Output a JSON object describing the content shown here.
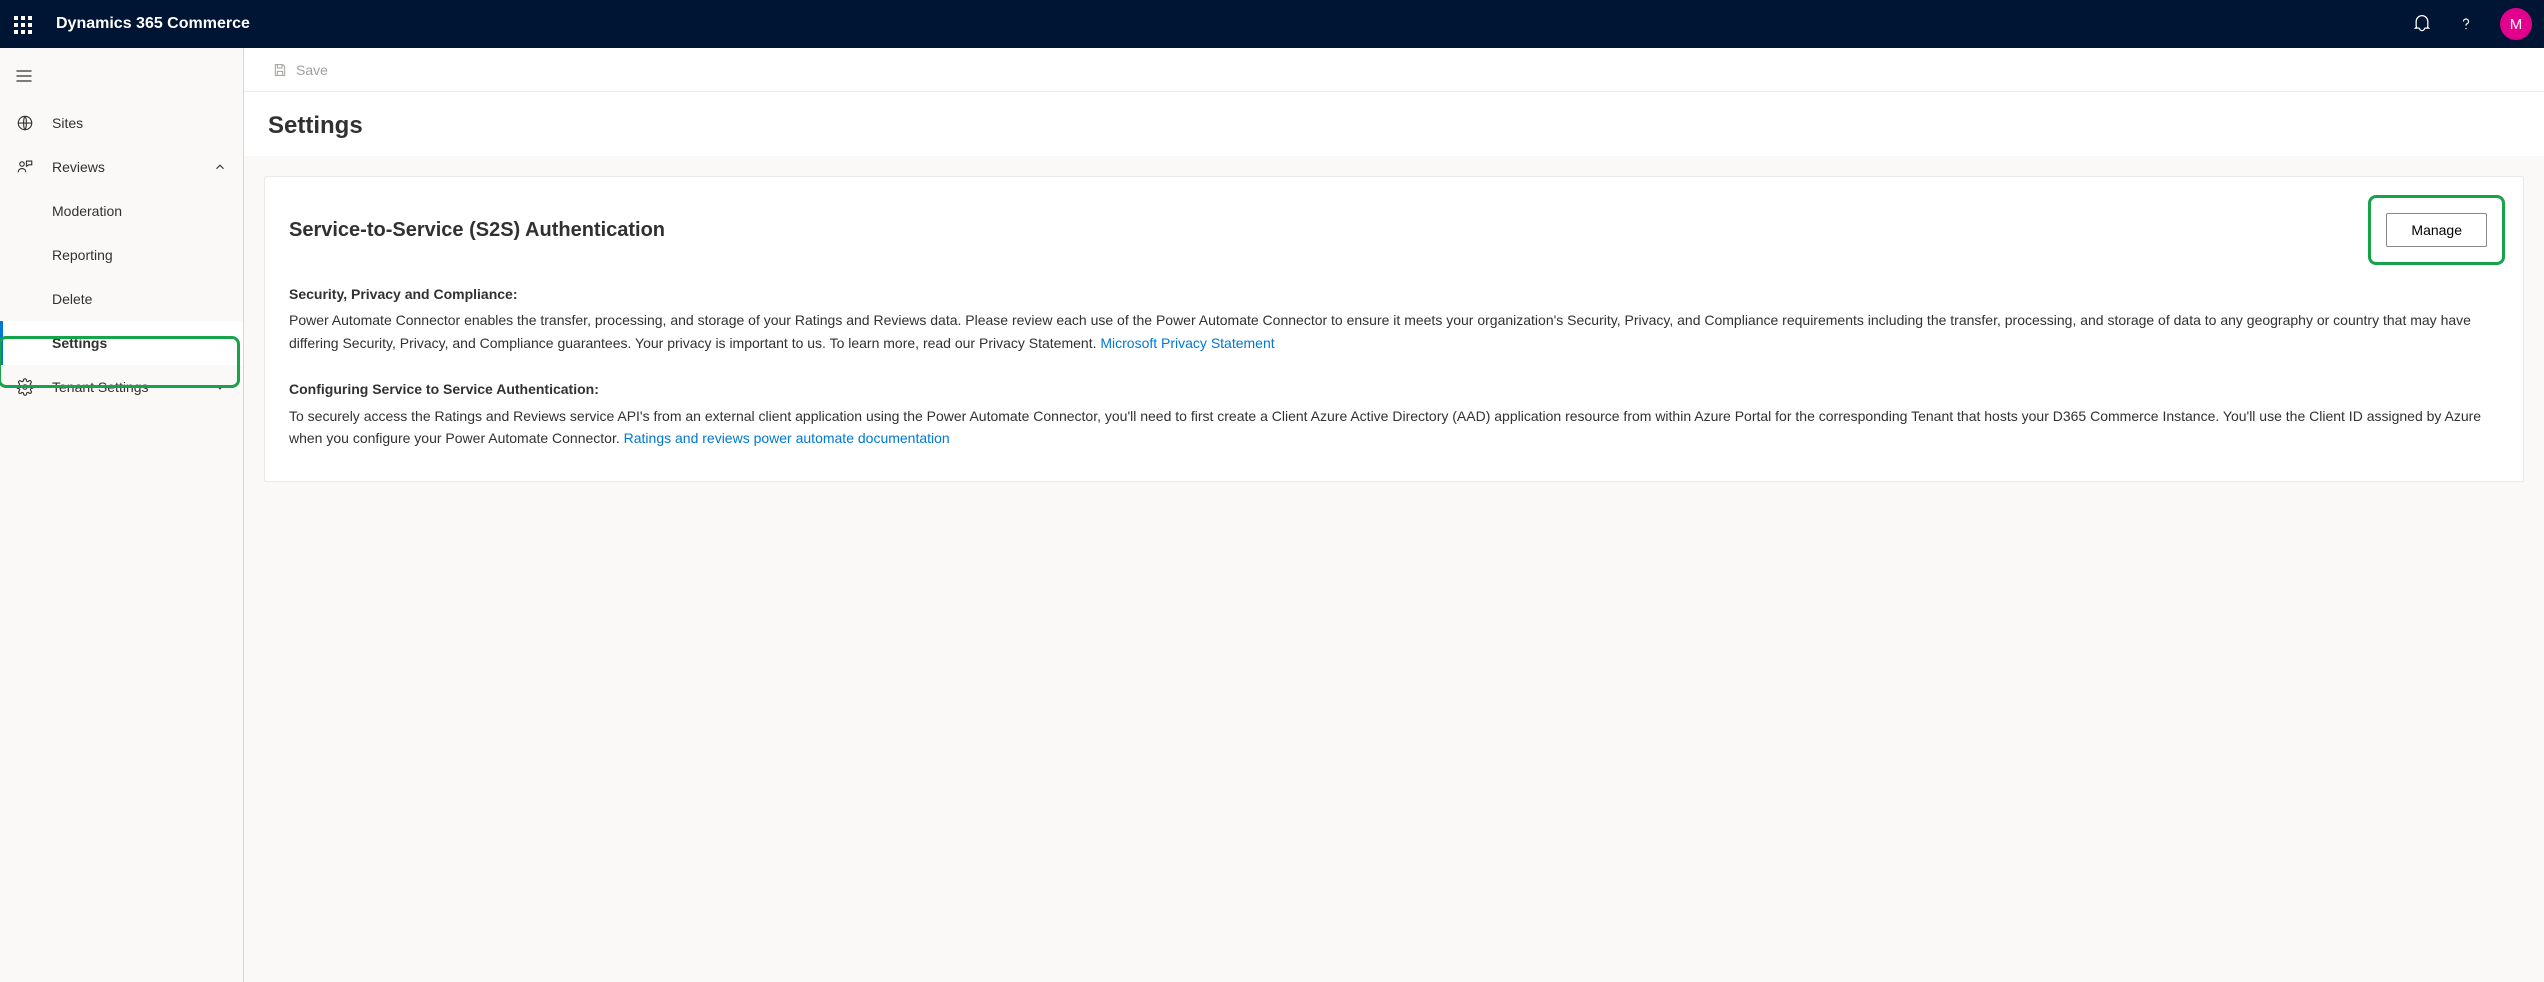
{
  "topbar": {
    "title": "Dynamics 365 Commerce",
    "avatar_initial": "M"
  },
  "sidebar": {
    "sites_label": "Sites",
    "reviews_label": "Reviews",
    "moderation_label": "Moderation",
    "reporting_label": "Reporting",
    "delete_label": "Delete",
    "settings_label": "Settings",
    "tenant_settings_label": "Tenant Settings"
  },
  "commandbar": {
    "save_label": "Save"
  },
  "page": {
    "title": "Settings"
  },
  "card": {
    "title": "Service-to-Service (S2S) Authentication",
    "manage_label": "Manage",
    "sec1_label": "Security, Privacy and Compliance:",
    "sec1_body": "Power Automate Connector enables the transfer, processing, and storage of your Ratings and Reviews data. Please review each use of the Power Automate Connector to ensure it meets your organization's Security, Privacy, and Compliance requirements including the transfer, processing, and storage of data to any geography or country that may have differing Security, Privacy, and Compliance guarantees. Your privacy is important to us. To learn more, read our Privacy Statement. ",
    "sec1_link": "Microsoft Privacy Statement",
    "sec2_label": "Configuring Service to Service Authentication:",
    "sec2_body": "To securely access the Ratings and Reviews service API's from an external client application using the Power Automate Connector, you'll need to first create a Client Azure Active Directory (AAD) application resource from within Azure Portal for the corresponding Tenant that hosts your D365 Commerce Instance. You'll use the Client ID assigned by Azure when you configure your Power Automate Connector. ",
    "sec2_link": "Ratings and reviews power automate documentation"
  }
}
